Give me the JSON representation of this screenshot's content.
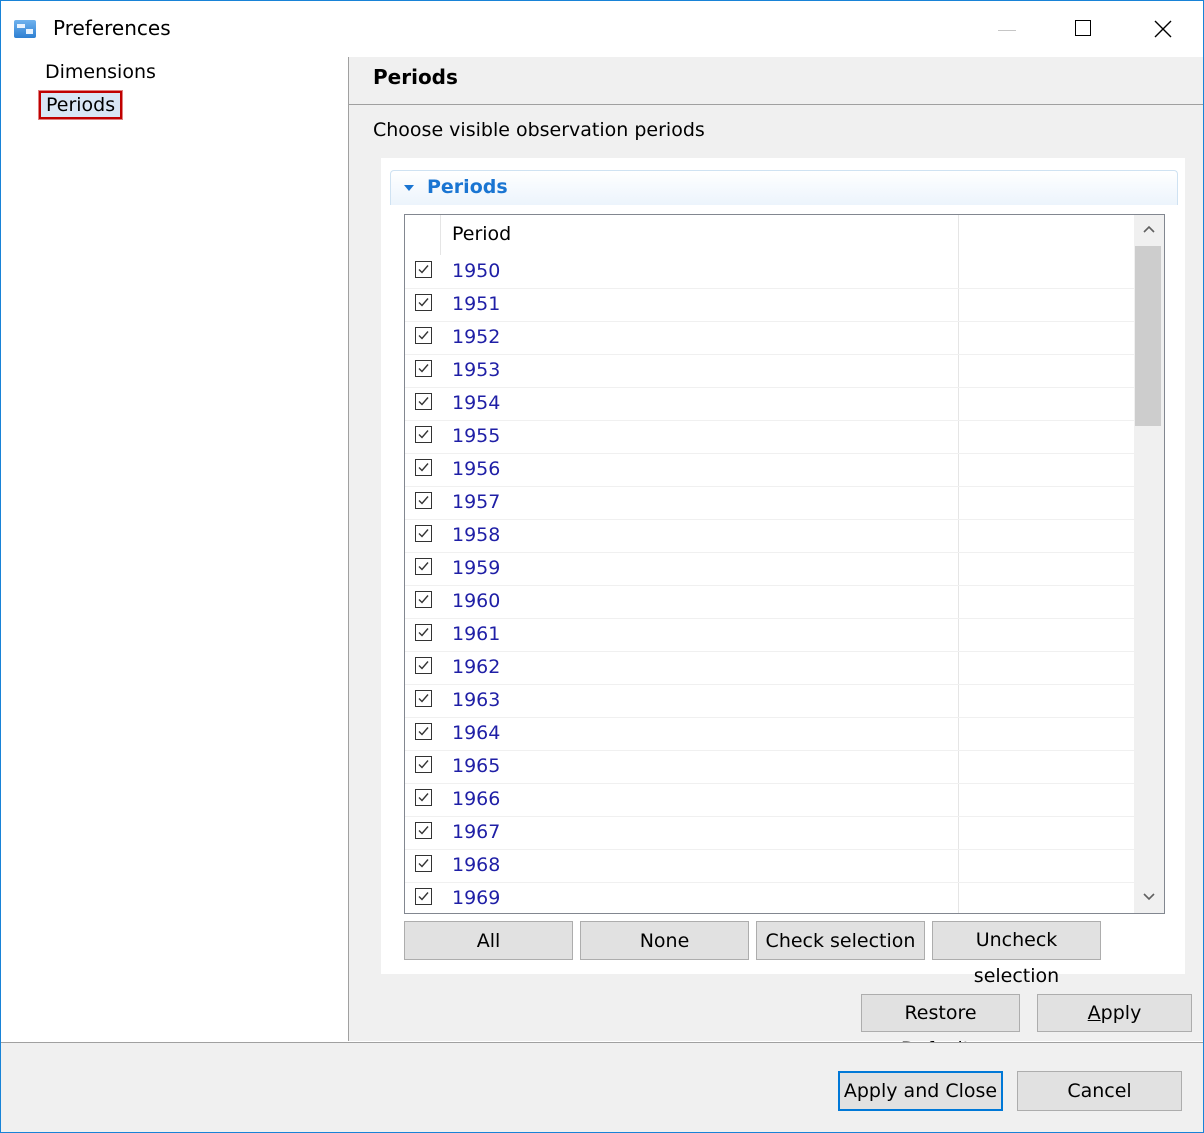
{
  "window": {
    "title": "Preferences"
  },
  "tree": {
    "items": [
      "Dimensions",
      "Periods"
    ],
    "selected": "Periods"
  },
  "page": {
    "title": "Periods",
    "description": "Choose visible observation periods",
    "section_title": "Periods",
    "table": {
      "column_header": "Period",
      "rows": [
        {
          "label": "1950",
          "checked": true
        },
        {
          "label": "1951",
          "checked": true
        },
        {
          "label": "1952",
          "checked": true
        },
        {
          "label": "1953",
          "checked": true
        },
        {
          "label": "1954",
          "checked": true
        },
        {
          "label": "1955",
          "checked": true
        },
        {
          "label": "1956",
          "checked": true
        },
        {
          "label": "1957",
          "checked": true
        },
        {
          "label": "1958",
          "checked": true
        },
        {
          "label": "1959",
          "checked": true
        },
        {
          "label": "1960",
          "checked": true
        },
        {
          "label": "1961",
          "checked": true
        },
        {
          "label": "1962",
          "checked": true
        },
        {
          "label": "1963",
          "checked": true
        },
        {
          "label": "1964",
          "checked": true
        },
        {
          "label": "1965",
          "checked": true
        },
        {
          "label": "1966",
          "checked": true
        },
        {
          "label": "1967",
          "checked": true
        },
        {
          "label": "1968",
          "checked": true
        },
        {
          "label": "1969",
          "checked": true
        }
      ]
    },
    "selection_buttons": {
      "all": "All",
      "none": "None",
      "check": "Check selection",
      "uncheck": "Uncheck selection"
    },
    "restore_defaults": {
      "before": "Restore ",
      "mnemonic": "D",
      "after": "efaults"
    },
    "apply": {
      "before": "",
      "mnemonic": "A",
      "after": "pply"
    }
  },
  "footer": {
    "apply_and_close": "Apply and Close",
    "cancel": "Cancel"
  },
  "colors": {
    "accent": "#1a75d2",
    "selection_border": "#c00000",
    "focus_border": "#0078d7"
  },
  "icons": [
    "app-icon",
    "minimize-icon",
    "maximize-icon",
    "close-icon",
    "collapse-arrow-icon",
    "checkbox-checked-icon",
    "scroll-up-icon",
    "scroll-down-icon"
  ]
}
